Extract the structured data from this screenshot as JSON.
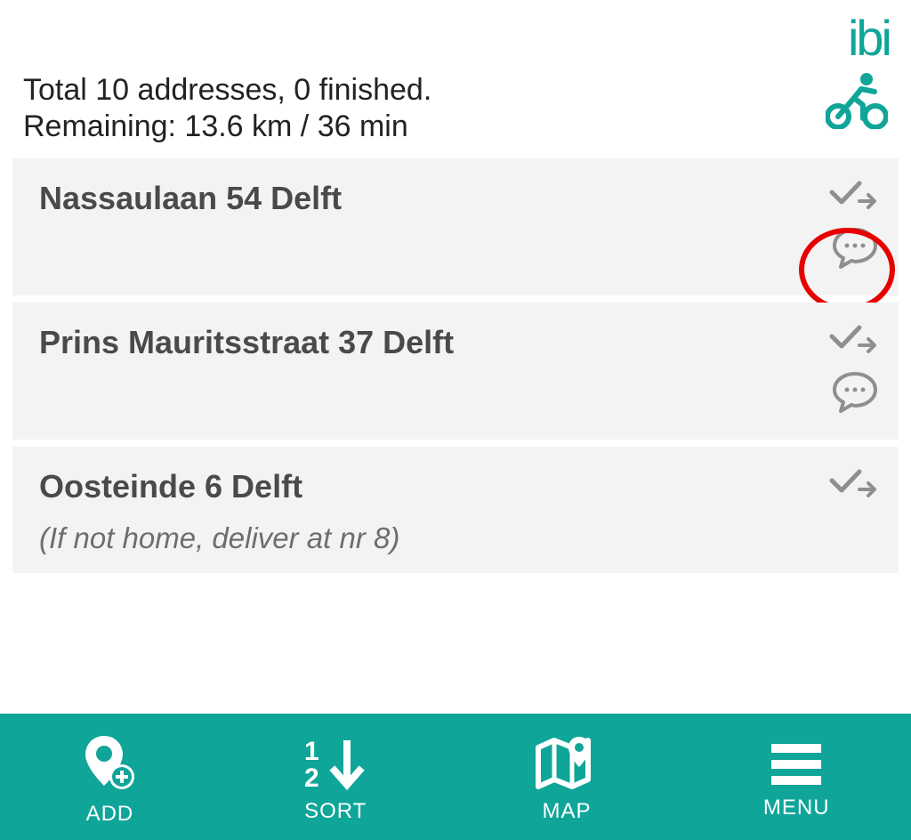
{
  "logo": "ibi",
  "status": {
    "line1": "Total 10 addresses, 0 finished.",
    "line2": "Remaining: 13.6 km / 36 min"
  },
  "addresses": [
    {
      "title": "Nassaulaan 54 Delft",
      "note": "",
      "highlight_chat": true,
      "show_chat": true
    },
    {
      "title": "Prins Mauritsstraat 37 Delft",
      "note": "",
      "highlight_chat": false,
      "show_chat": true
    },
    {
      "title": "Oosteinde 6 Delft",
      "note": "(If not home, deliver at nr 8)",
      "highlight_chat": false,
      "show_chat": false
    }
  ],
  "bottombar": {
    "add": "ADD",
    "sort": "SORT",
    "map": "MAP",
    "menu": "MENU"
  },
  "colors": {
    "brand": "#0fa599",
    "highlight": "#e60000"
  }
}
